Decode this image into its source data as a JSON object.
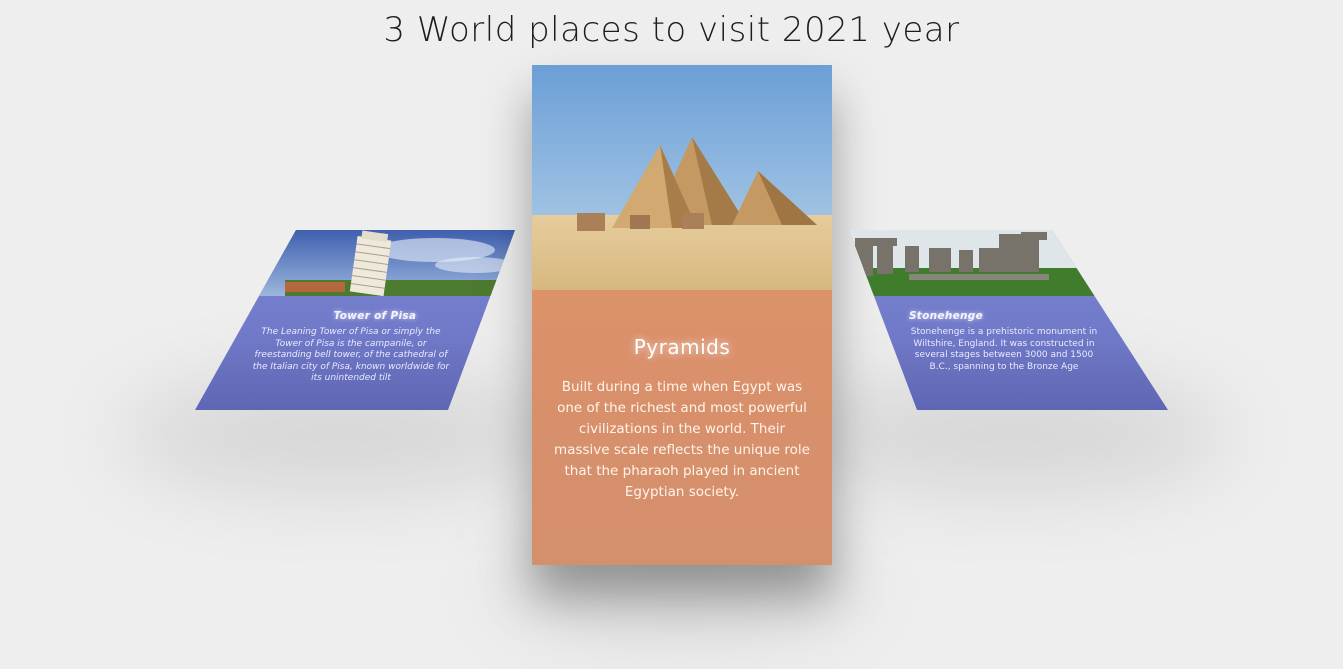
{
  "page": {
    "title": "3 World places to visit 2021 year"
  },
  "cards": [
    {
      "title": "Tower of Pisa",
      "description": "The Leaning Tower of Pisa or simply the Tower of Pisa is the campanile, or freestanding bell tower, of the cathedral of the Italian city of Pisa, known worldwide for its unintended tilt",
      "image_icon": "leaning-tower-photo"
    },
    {
      "title": "Pyramids",
      "description": "Built during a time when Egypt was one of the richest and most powerful civilizations in the world. Their massive scale reflects the unique role that the pharaoh played in ancient Egyptian society.",
      "image_icon": "pyramids-photo"
    },
    {
      "title": "Stonehenge",
      "description": "Stonehenge is a prehistoric monument in Wiltshire, England. It was constructed in several stages between 3000 and 1500 B.C., spanning to the Bronze Age",
      "image_icon": "stonehenge-photo"
    }
  ],
  "colors": {
    "background": "#eeeeee",
    "side_card": "#7079c7",
    "center_card": "#e8a153"
  }
}
